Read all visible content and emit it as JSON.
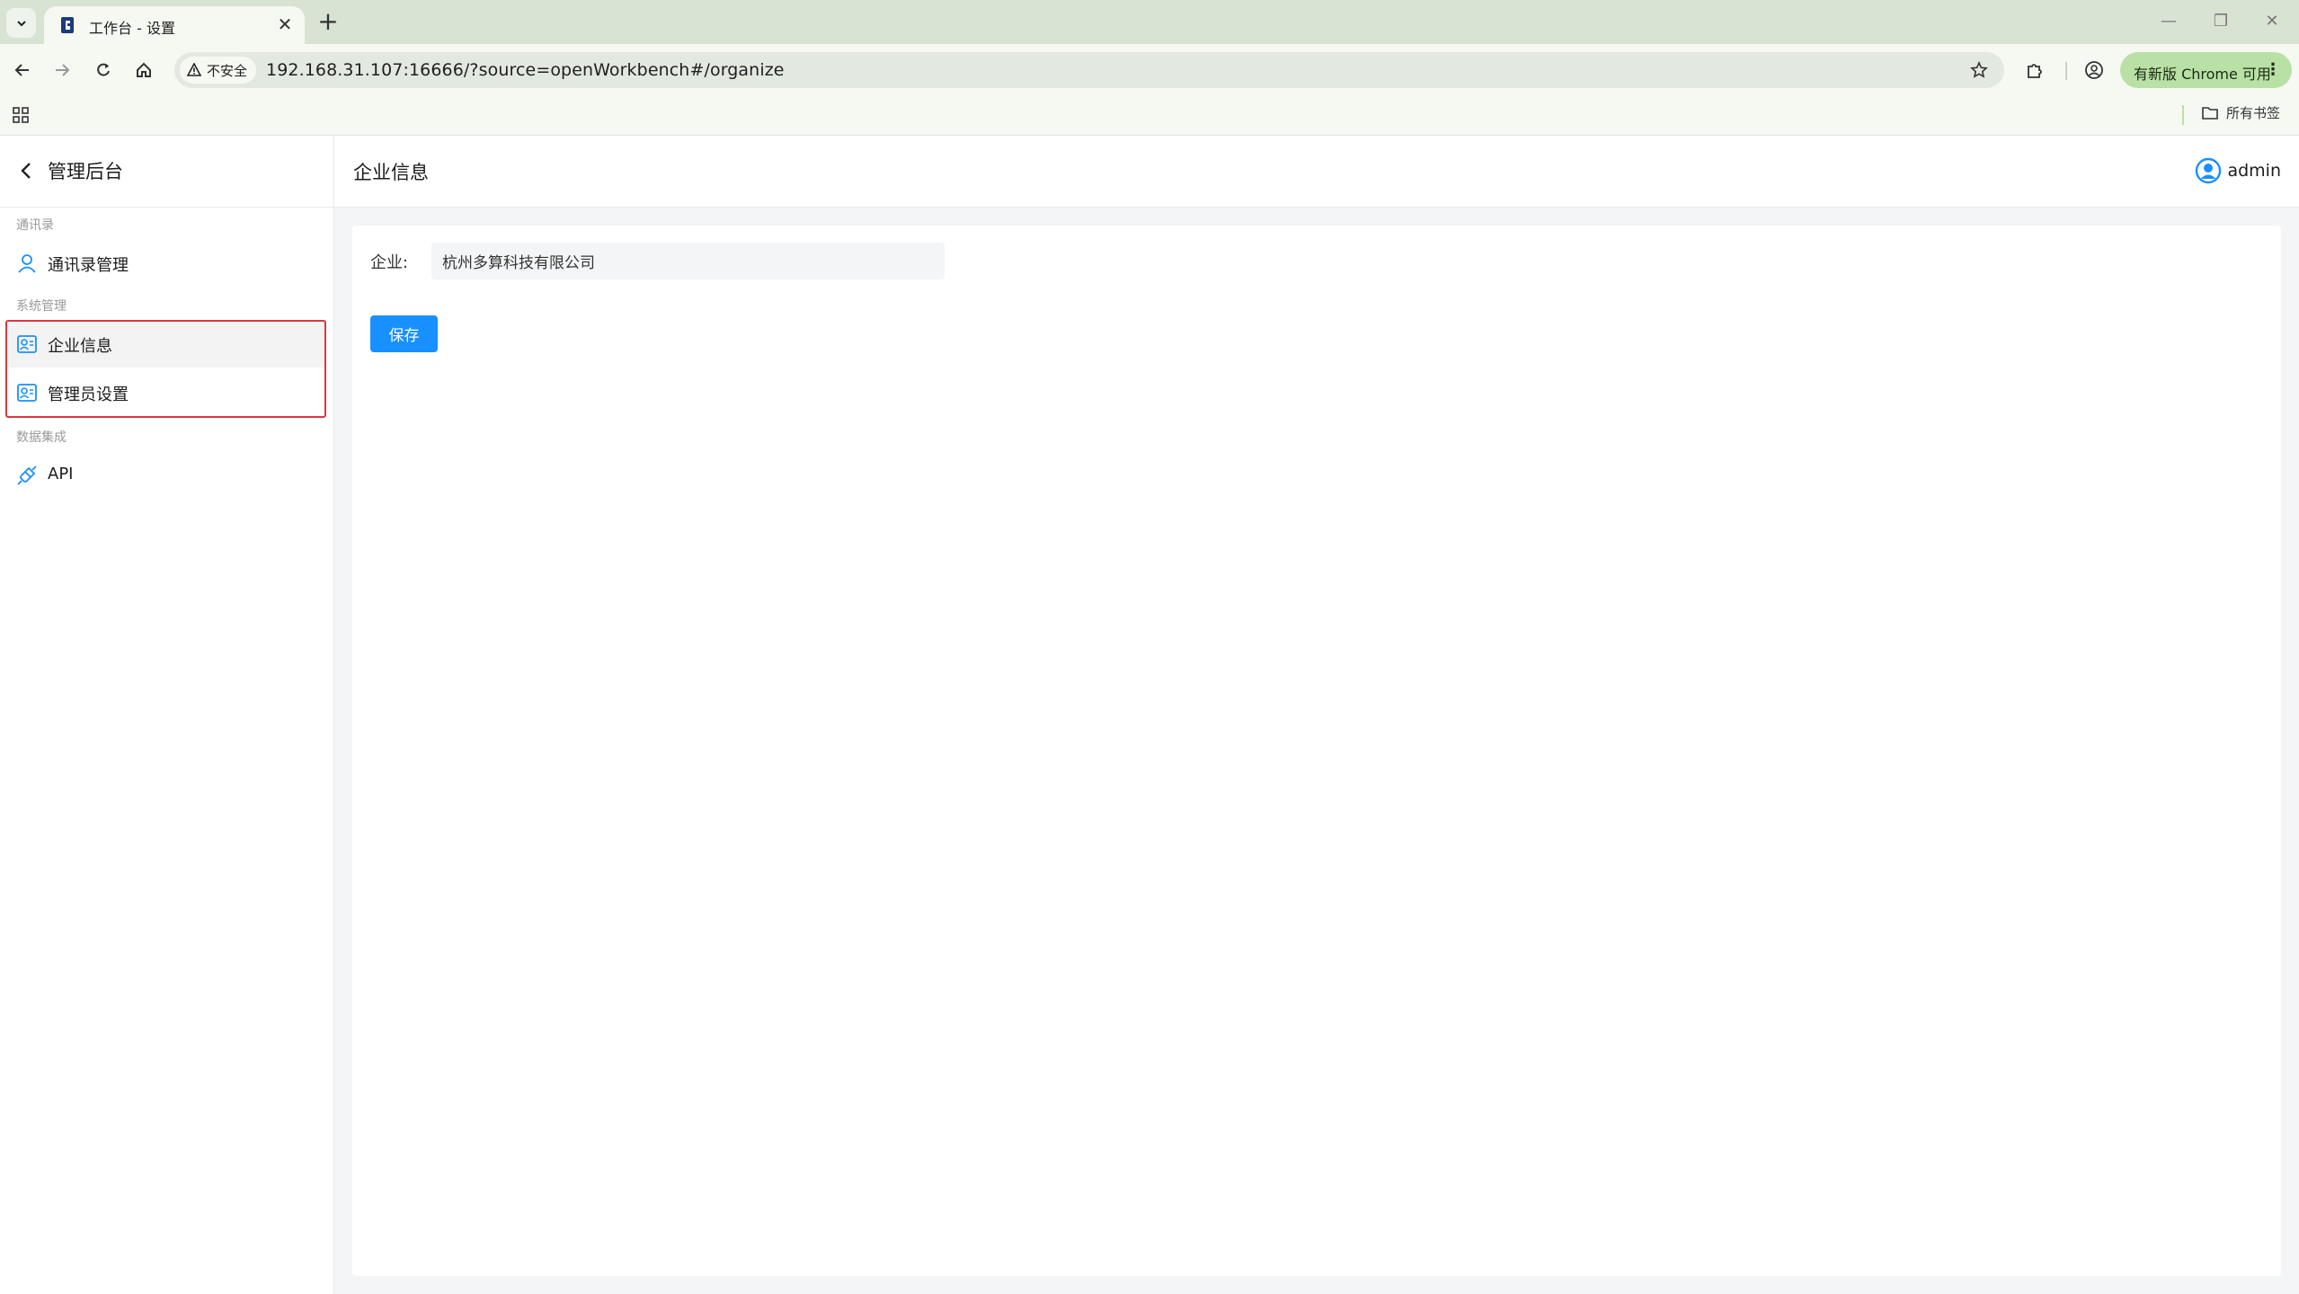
{
  "browser": {
    "tab_title": "工作台 - 设置",
    "security_label": "不安全",
    "url": "192.168.31.107:16666/?source=openWorkbench#/organize",
    "update_label": "有新版 Chrome 可用",
    "all_bookmarks_label": "所有书签"
  },
  "sidebar": {
    "title": "管理后台",
    "groups": [
      {
        "label": "通讯录",
        "items": [
          {
            "label": "通讯录管理",
            "icon": "user-icon"
          }
        ]
      },
      {
        "label": "系统管理",
        "items": [
          {
            "label": "企业信息",
            "icon": "contact-card-icon",
            "active": true
          },
          {
            "label": "管理员设置",
            "icon": "contact-card-icon"
          }
        ]
      },
      {
        "label": "数据集成",
        "items": [
          {
            "label": "API",
            "icon": "api-plug-icon"
          }
        ]
      }
    ]
  },
  "main": {
    "title": "企业信息",
    "user_name": "admin",
    "form": {
      "company_label": "企业:",
      "company_value": "杭州多算科技有限公司",
      "save_label": "保存"
    }
  },
  "colors": {
    "primary": "#1890ff",
    "highlight_border": "#d9393f",
    "tabbar_bg": "#d9e3d4",
    "update_chip": "#b9e0a5"
  }
}
